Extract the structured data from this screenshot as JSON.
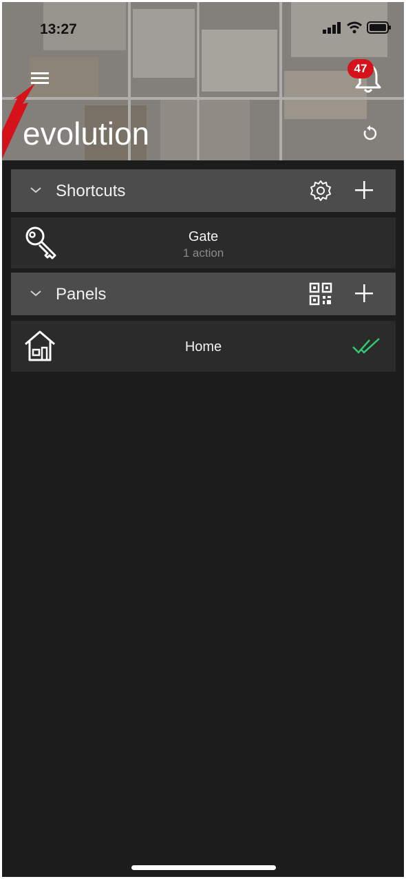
{
  "status_bar": {
    "time": "13:27"
  },
  "header": {
    "app_title": "evolution",
    "notification_count": "47",
    "accent_color": "#d5111a"
  },
  "shortcuts": {
    "label": "Shortcuts",
    "items": [
      {
        "name": "Gate",
        "subtitle": "1 action",
        "icon": "key-icon"
      }
    ]
  },
  "panels": {
    "label": "Panels",
    "items": [
      {
        "name": "Home",
        "icon": "house-icon",
        "status": "double-check-icon",
        "status_color": "#2ecc71"
      }
    ]
  }
}
